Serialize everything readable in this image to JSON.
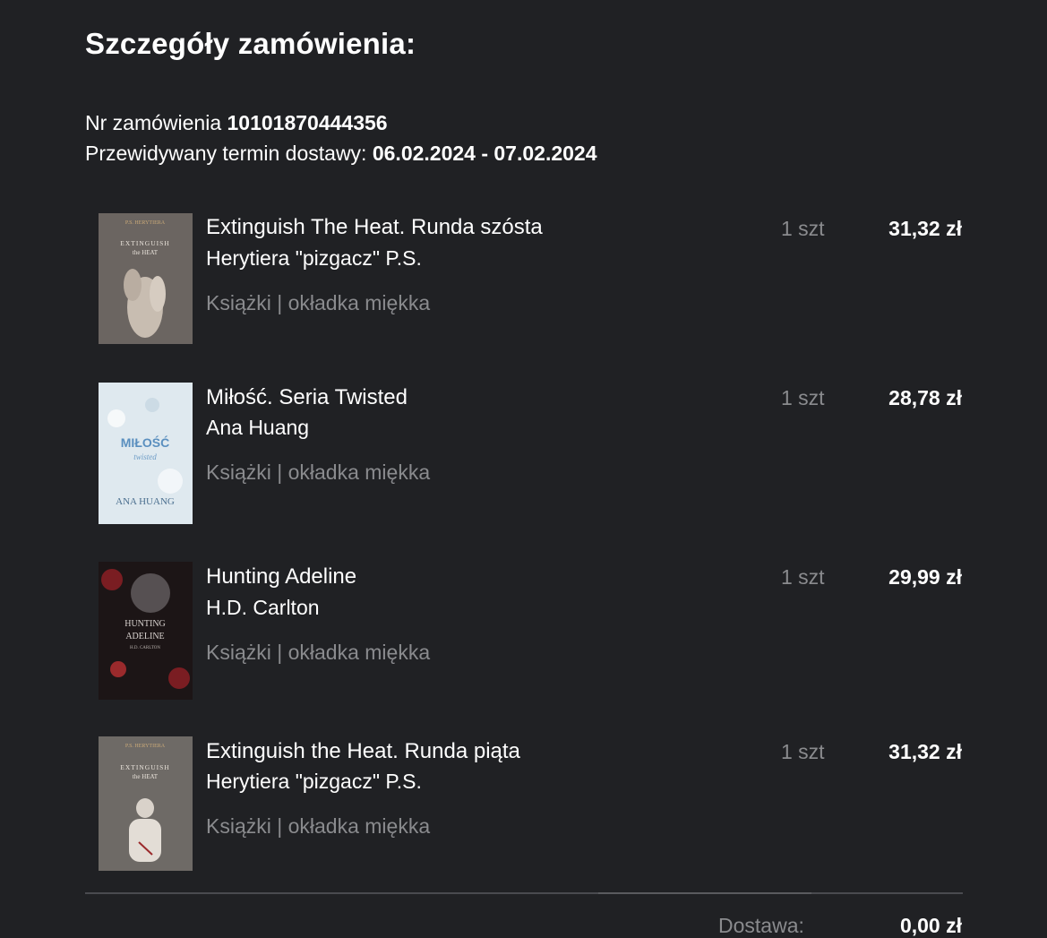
{
  "order": {
    "title": "Szczegóły zamówienia:",
    "number_label": "Nr zamówienia",
    "number_value": "10101870444356",
    "delivery_label": "Przewidywany termin dostawy:",
    "delivery_value": "06.02.2024 - 07.02.2024"
  },
  "items": [
    {
      "name": "Extinguish The Heat. Runda szósta",
      "author": "Herytiera \"pizgacz\" P.S.",
      "variant": "Książki | okładka miękka",
      "qty": "1 szt",
      "price": "31,32 zł",
      "cover": {
        "top_text": "P.S. HERYTIERA",
        "title1": "EXTINGUISH",
        "title2": "the HEAT",
        "bg": "#6b6561"
      }
    },
    {
      "name": "Miłość. Seria Twisted",
      "author": "Ana Huang",
      "variant": "Książki | okładka miękka",
      "qty": "1 szt",
      "price": "28,78 zł",
      "cover": {
        "title1": "MIŁOŚĆ",
        "title2": "twisted",
        "author": "ANA HUANG",
        "bg": "#dfe9ef"
      }
    },
    {
      "name": "Hunting Adeline",
      "author": "H.D. Carlton",
      "variant": "Książki | okładka miękka",
      "qty": "1 szt",
      "price": "29,99 zł",
      "cover": {
        "title1": "HUNTING",
        "title2": "ADELINE",
        "author": "H.D. CARLTON",
        "bg": "#1c1516"
      }
    },
    {
      "name": "Extinguish the Heat. Runda piąta",
      "author": "Herytiera \"pizgacz\" P.S.",
      "variant": "Książki | okładka miękka",
      "qty": "1 szt",
      "price": "31,32 zł",
      "cover": {
        "top_text": "P.S. HERYTIERA",
        "title1": "EXTINGUISH",
        "title2": "the HEAT",
        "bg": "#6e6a66"
      }
    }
  ],
  "summary": {
    "shipping_label": "Dostawa:",
    "shipping_value": "0,00 zł"
  }
}
